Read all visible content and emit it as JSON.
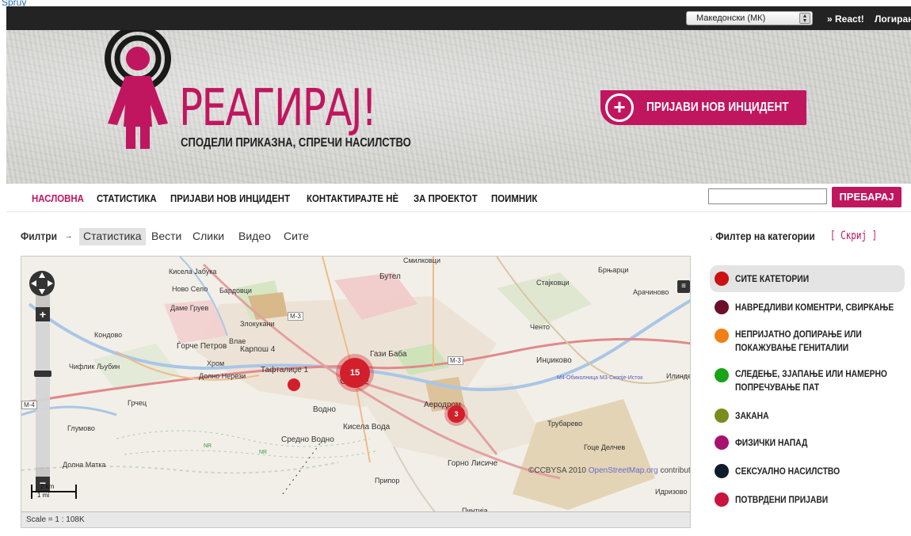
{
  "frame": {
    "link_text": "Spruy"
  },
  "topbar": {
    "language_selected": "Македонски (МК)",
    "react_link": "» React!",
    "login_link": "Логирање"
  },
  "header": {
    "brand_title": "РЕАГИРАЈ!",
    "tagline": "СПОДЕЛИ ПРИКАЗНА, СПРЕЧИ НАСИЛСТВО",
    "report_button": "ПРИЈАВИ НОВ ИНЦИДЕНТ",
    "brand_color": "#c0165f"
  },
  "nav": {
    "items": [
      {
        "label": "НАСЛОВНА",
        "active": true
      },
      {
        "label": "СТАТИСТИКА"
      },
      {
        "label": "ПРИЈАВИ НОВ ИНЦИДЕНТ"
      },
      {
        "label": "КОНТАКТИРАЈТЕ НÈ"
      },
      {
        "label": "ЗА ПРОЕКТОТ"
      },
      {
        "label": "ПОИМНИК"
      }
    ],
    "search_value": "",
    "search_button": "ПРЕБАРАЈ"
  },
  "filters": {
    "label": "Филтри",
    "arrow": "→",
    "tabs": [
      "Статистика",
      "Вести",
      "Слики",
      "Видео",
      "Сите"
    ],
    "active_tab": "Статистика"
  },
  "map": {
    "labels": {
      "kisela_jabuka": "Кисела Јабука",
      "novo_selo": "Ново Село",
      "bardovci": "Бардовци",
      "dame_gruev": "Даме Груев",
      "butel": "Бутел",
      "smilkovci": "Смилковци",
      "brnjarci": "Брњарци",
      "stajkovci": "Стајковци",
      "arachinovo": "Арачиново",
      "kondovo": "Кондово",
      "zlokukjani": "Злокукани",
      "gorce_petrov": "Ѓорче Петров",
      "vlae": "Влае",
      "karposh": "Карпош 4",
      "gazi_baba": "Гази Баба",
      "chento": "Ченто",
      "chiflik": "Чифлик Љубин",
      "hrom": "Хром",
      "dolno_nerezi": "Долно Нерези",
      "taftalidze": "Тафталиџе 1",
      "skopje": "Скопје",
      "indzikovo": "Инџиково",
      "ilinden": "Илинден",
      "grchec": "Грчец",
      "vodno": "Водно",
      "aerodrom": "Аеродром",
      "trubarevo": "Трубарево",
      "glumovo": "Глумово",
      "kisela_voda": "Кисела Вода",
      "sredno_vodno": "Средно Водно",
      "goce_delchev": "Гоце Делчев",
      "dolna_matka": "Долна Матка",
      "gorno_lisiche": "Горно Лисиче",
      "pripor": "Припор",
      "idrizovo": "Идризово",
      "pintija": "Пинтија",
      "road_m3": "M-3",
      "road_m3b": "M-3",
      "road_m4": "M-4",
      "road_link": "М4-Обиколница М3-Скопје-Исток",
      "nr": "NR"
    },
    "clusters": [
      {
        "count": "15"
      },
      {
        "count": "3"
      },
      {
        "count": ""
      }
    ],
    "attribution_prefix": "©CCBYSA 2010 ",
    "attribution_osm": "OpenStreetMap.org",
    "attribution_suffix": " contributors",
    "scale_text": "Scale = 1 : 108K",
    "scale_km": "2 km",
    "scale_mi": "1 mi",
    "zoom_in": "+",
    "zoom_out": "−"
  },
  "categories": {
    "header": "Филтер на категории",
    "header_arrow": "↓",
    "hide_label": "[ Скриј ]",
    "items": [
      {
        "label": "СИТЕ КАТЕТОРИИ",
        "color": "#cc1111",
        "active": true
      },
      {
        "label": "НАВРЕДЛИВИ КОМЕНТРИ, СВИРКАЊЕ",
        "color": "#6b0f2a"
      },
      {
        "label": "НЕПРИЈАТНО ДОПИРАЊЕ ИЛИ ПОКАЖУВАЊЕ ГЕНИТАЛИИ",
        "color": "#f07f17"
      },
      {
        "label": "СЛЕДЕЊЕ, ЗЈАПАЊЕ ИЛИ НАМЕРНО ПОПРЕЧУВАЊЕ ПАТ",
        "color": "#1aa31a"
      },
      {
        "label": "ЗАКАНА",
        "color": "#7c8b1b"
      },
      {
        "label": "ФИЗИЧКИ НАПАД",
        "color": "#a8126d"
      },
      {
        "label": "СЕКСУАЛНО НАСИЛСТВО",
        "color": "#0f1b2e"
      },
      {
        "label": "ПОТВРДЕНИ ПРИЈАВИ",
        "color": "#c8143f"
      }
    ]
  }
}
